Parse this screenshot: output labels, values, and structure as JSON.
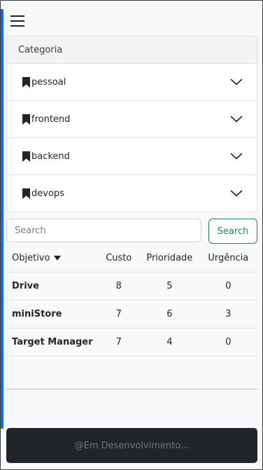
{
  "accordion": {
    "header": "Categoria",
    "items": [
      {
        "label": "pessoal"
      },
      {
        "label": "frontend"
      },
      {
        "label": "backend"
      },
      {
        "label": "devops"
      }
    ]
  },
  "search": {
    "placeholder": "Search",
    "button_label": "Search"
  },
  "table": {
    "columns": [
      "Objetivo",
      "Custo",
      "Prioridade",
      "Urgência"
    ],
    "rows": [
      {
        "objetivo": "Drive",
        "custo": "8",
        "prioridade": "5",
        "urgencia": "0"
      },
      {
        "objetivo": "miniStore",
        "custo": "7",
        "prioridade": "6",
        "urgencia": "3"
      },
      {
        "objetivo": "Target Manager",
        "custo": "7",
        "prioridade": "4",
        "urgencia": "0"
      }
    ]
  },
  "footer": {
    "text": "@Em Desenvolvimento..."
  },
  "colors": {
    "accent": "#0d6efd",
    "success": "#198754",
    "footer_bg": "#212529"
  },
  "icons": [
    "menu-icon",
    "bookmark-icon",
    "chevron-down-icon",
    "sort-caret-icon"
  ]
}
